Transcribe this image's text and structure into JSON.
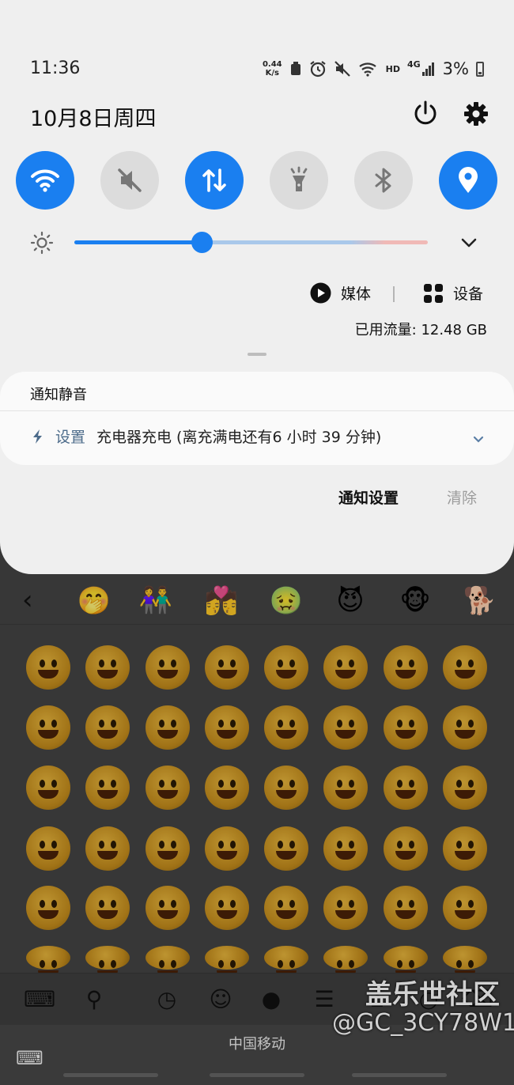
{
  "status_bar": {
    "time": "11:36",
    "net_speed_value": "0.44",
    "net_speed_unit": "K/s",
    "hd_label": "HD",
    "network_label": "4G",
    "battery_percent": "3%"
  },
  "header": {
    "date": "10月8日周四"
  },
  "quick_settings": [
    {
      "name": "wifi",
      "state": "on"
    },
    {
      "name": "mute",
      "state": "off"
    },
    {
      "name": "mobile-data",
      "state": "on"
    },
    {
      "name": "flashlight",
      "state": "off"
    },
    {
      "name": "bluetooth",
      "state": "off"
    },
    {
      "name": "location",
      "state": "on"
    }
  ],
  "brightness": {
    "level": 0.36
  },
  "media": {
    "media_label": "媒体",
    "devices_label": "设备"
  },
  "data_usage": {
    "label": "已用流量: 12.48 GB"
  },
  "notification": {
    "section_title": "通知静音",
    "app_name": "设置",
    "text": "充电器充电 (离充满电还有6 小时 39 分钟)"
  },
  "actions": {
    "settings_label": "通知设置",
    "clear_label": "清除"
  },
  "keyboard": {
    "carrier": "中国移动",
    "watermark_title": "盖乐世社区",
    "watermark_user": "@GC_3CY78W1"
  },
  "colors": {
    "accent": "#1a7ff0",
    "shade_bg": "#efefef",
    "card_bg": "#fafafa",
    "inactive_tile": "#dcdcdc"
  }
}
